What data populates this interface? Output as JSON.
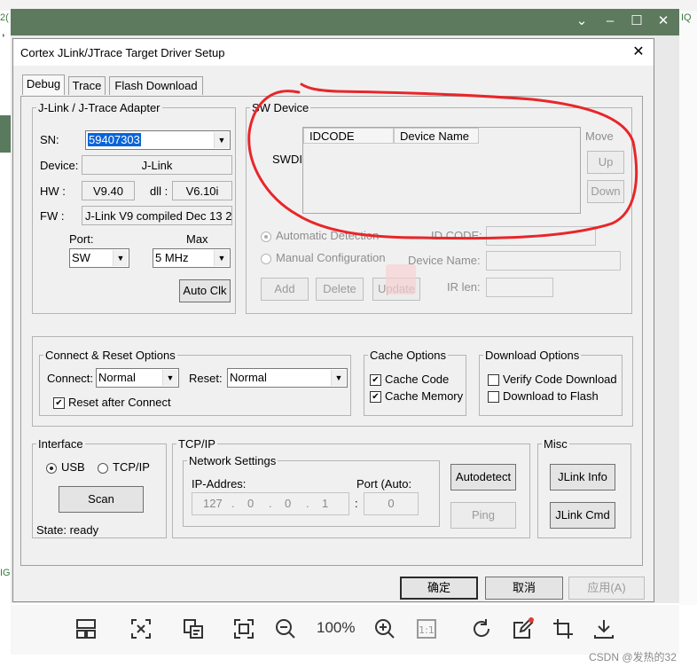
{
  "background_app": {
    "fragment_top_left": "2(",
    "fragment_left": ",",
    "fragment_right": "IQ",
    "fragment_left_low": "IG"
  },
  "viewer": {
    "zoom_label": "100%",
    "watermark_text": "CSDN @发热的32",
    "tool_icons": [
      "thumbnails-icon",
      "ocr-text-icon",
      "copy-text-icon",
      "fit-screen-icon",
      "zoom-out-icon",
      "zoom-in-icon",
      "actual-size-icon",
      "rotate-icon",
      "annotate-icon",
      "crop-icon",
      "download-icon"
    ]
  },
  "dialog": {
    "title": "Cortex JLink/JTrace Target Driver Setup",
    "tabs": [
      {
        "label": "Debug",
        "active": true
      },
      {
        "label": "Trace",
        "active": false
      },
      {
        "label": "Flash Download",
        "active": false
      }
    ],
    "adapter": {
      "legend": "J-Link / J-Trace Adapter",
      "sn_label": "SN:",
      "sn_value": "59407303",
      "device_label": "Device:",
      "device_value": "J-Link",
      "hw_label": "HW :",
      "hw_value": "V9.40",
      "dll_label": "dll :",
      "dll_value": "V6.10i",
      "fw_label": "FW :",
      "fw_value": "J-Link V9 compiled Dec 13 2",
      "port_label": "Port:",
      "port_value": "SW",
      "max_label": "Max",
      "max_value": "5 MHz",
      "autoclk_label": "Auto Clk"
    },
    "sw_device": {
      "legend": "SW Device",
      "swdi_label": "SWDI",
      "col_idcode": "IDCODE",
      "col_device_name": "Device Name",
      "move_label": "Move",
      "up_label": "Up",
      "down_label": "Down",
      "auto_detect_label": "Automatic Detection",
      "manual_config_label": "Manual Configuration",
      "idcode_label": "ID CODE:",
      "device_name_label": "Device Name:",
      "ir_len_label": "IR len:",
      "add_label": "Add",
      "delete_label": "Delete",
      "update_label": "Update"
    },
    "connect_reset": {
      "legend": "Connect & Reset Options",
      "connect_label": "Connect:",
      "connect_value": "Normal",
      "reset_label": "Reset:",
      "reset_value": "Normal",
      "reset_after_connect_label": "Reset after Connect",
      "reset_after_connect_checked": true
    },
    "cache": {
      "legend": "Cache Options",
      "cache_code_label": "Cache Code",
      "cache_code_checked": true,
      "cache_memory_label": "Cache Memory",
      "cache_memory_checked": true
    },
    "download": {
      "legend": "Download Options",
      "verify_label": "Verify Code Download",
      "verify_checked": false,
      "to_flash_label": "Download to Flash",
      "to_flash_checked": false
    },
    "interface": {
      "legend": "Interface",
      "usb_label": "USB",
      "tcpip_label": "TCP/IP",
      "scan_label": "Scan",
      "state_label": "State: ready"
    },
    "tcpip": {
      "legend": "TCP/IP",
      "network_legend": "Network Settings",
      "ip_label": "IP-Addres:",
      "ip_octets": [
        "127",
        "0",
        "0",
        "1"
      ],
      "port_label": "Port (Auto:",
      "port_value": "0",
      "autodetect_label": "Autodetect",
      "ping_label": "Ping"
    },
    "misc": {
      "legend": "Misc",
      "jlink_info_label": "JLink Info",
      "jlink_cmd_label": "JLink Cmd"
    },
    "footer": {
      "ok_label": "确定",
      "cancel_label": "取消",
      "apply_label": "应用(A)"
    }
  },
  "annotation": {
    "shape": "hand-drawn red ellipse",
    "color": "#e8262a"
  }
}
